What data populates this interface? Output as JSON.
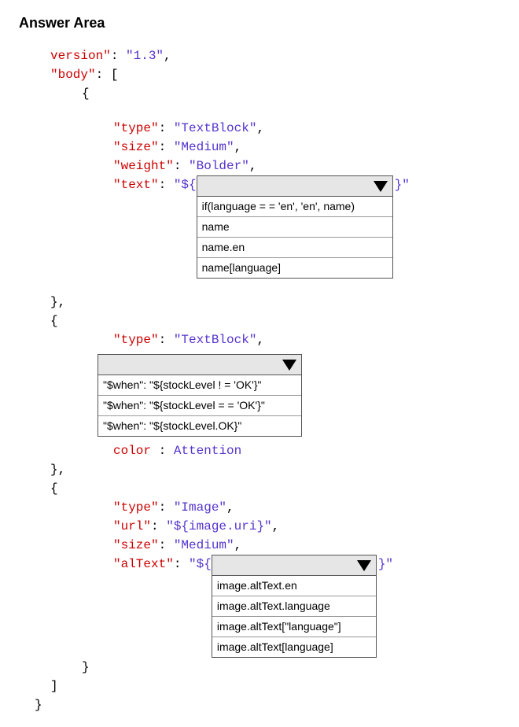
{
  "header": "Answer Area",
  "code": {
    "version_key": "version\"",
    "version_val": "\"1.3\"",
    "body_key": "\"body\"",
    "block1": {
      "type_key": "\"type\"",
      "type_val": "\"TextBlock\"",
      "size_key": "\"size\"",
      "size_val": "\"Medium\"",
      "weight_key": "\"weight\"",
      "weight_val": "\"Bolder\"",
      "text_key": "\"text\"",
      "text_prefix": "\"${",
      "text_suffix": "}\""
    },
    "block2": {
      "type_key": "\"type\"",
      "type_val": "\"TextBlock\"",
      "color_key": "color",
      "color_val": "Attention"
    },
    "block3": {
      "type_key": "\"type\"",
      "type_val": "\"Image\"",
      "url_key": "\"url\"",
      "url_val": "\"${image.uri}\"",
      "size_key": "\"size\"",
      "size_val": "\"Medium\"",
      "alt_key": "\"alText\"",
      "alt_prefix": "\"${",
      "alt_suffix": "}\""
    },
    "punct": {
      "colon": ":",
      "colon_sp": ": ",
      "comma": ",",
      "openBracket": "[",
      "closeBracket": "]",
      "openBrace": "{",
      "closeBrace": "}",
      "closeBraceComma": "},"
    }
  },
  "dropdown1": {
    "options": [
      "if(language = = 'en', 'en', name)",
      "name",
      "name.en",
      "name[language]"
    ]
  },
  "dropdown2": {
    "options": [
      "\"$when\": \"${stockLevel ! = 'OK'}\"",
      "\"$when\": \"${stockLevel = = 'OK'}\"",
      "\"$when\": \"${stockLevel.OK}\""
    ]
  },
  "dropdown3": {
    "options": [
      "image.altText.en",
      "image.altText.language",
      "image.altText[\"language\"]",
      "image.altText[language]"
    ]
  }
}
